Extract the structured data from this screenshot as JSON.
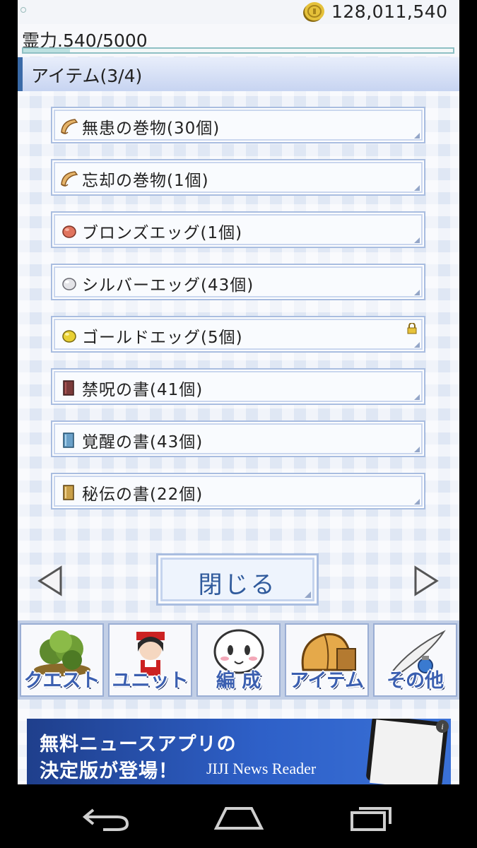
{
  "status": {
    "money": "128,011,540銭",
    "spirit": "霊力.540/5000",
    "spirit_fraction": 0.108
  },
  "section": {
    "title": "アイテム(3/4)"
  },
  "items": [
    {
      "label": "無患の巻物(30個)",
      "icon": "scroll-icon",
      "locked": false
    },
    {
      "label": "忘却の巻物(1個)",
      "icon": "scroll-icon",
      "locked": false
    },
    {
      "label": "ブロンズエッグ(1個)",
      "icon": "bronze-egg-icon",
      "locked": false
    },
    {
      "label": "シルバーエッグ(43個)",
      "icon": "silver-egg-icon",
      "locked": false
    },
    {
      "label": "ゴールドエッグ(5個)",
      "icon": "gold-egg-icon",
      "locked": true
    },
    {
      "label": "禁呪の書(41個)",
      "icon": "red-book-icon",
      "locked": false
    },
    {
      "label": "覚醒の書(43個)",
      "icon": "blue-book-icon",
      "locked": false
    },
    {
      "label": "秘伝の書(22個)",
      "icon": "gold-book-icon",
      "locked": false
    }
  ],
  "nav": {
    "close_label": "閉じる"
  },
  "menu": [
    {
      "label": "クエスト",
      "icon": "quest-icon"
    },
    {
      "label": "ユニット",
      "icon": "unit-icon"
    },
    {
      "label": "編 成",
      "icon": "formation-icon"
    },
    {
      "label": "アイテム",
      "icon": "item-bag-icon"
    },
    {
      "label": "その他",
      "icon": "other-quill-icon"
    }
  ],
  "ad": {
    "line1": "無料ニュースアプリの",
    "line2": "決定版が登場！",
    "brand": "JIJI News Reader",
    "info": "i"
  },
  "colors": {
    "accent": "#3a6aa8",
    "menu_text": "#3b5fb0",
    "close_text": "#2f5a9c",
    "ad_bg": "#2e60c8"
  }
}
